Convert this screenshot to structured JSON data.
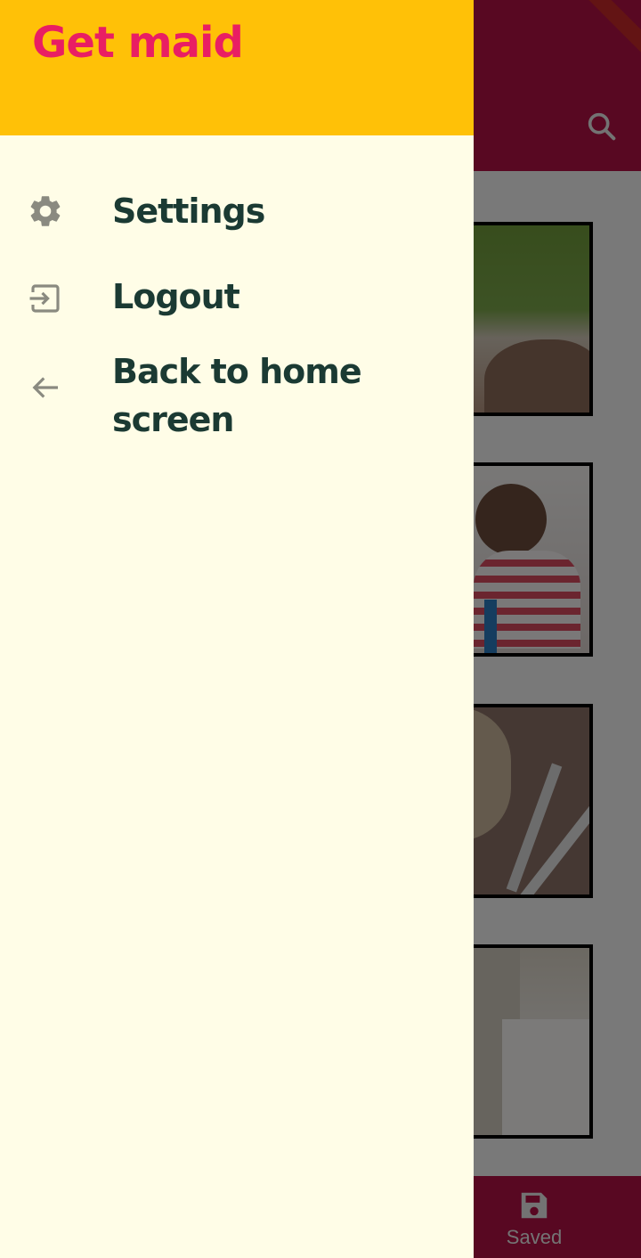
{
  "drawer": {
    "title": "Get maid",
    "items": [
      {
        "label": "Settings",
        "icon": "gear-icon"
      },
      {
        "label": "Logout",
        "icon": "logout-icon"
      },
      {
        "label": "Back to home screen",
        "icon": "arrow-back-icon"
      }
    ]
  },
  "background": {
    "bottom_nav": {
      "saved_label": "Saved",
      "saved_icon": "save-icon"
    },
    "app_bar": {
      "search_icon": "search-icon"
    }
  },
  "colors": {
    "app_bar": "#b11045",
    "drawer_header": "#ffc107",
    "drawer_body": "#fffde7",
    "title": "#e91e63",
    "menu_text": "#1b3a33",
    "icon": "#8a8a80"
  }
}
